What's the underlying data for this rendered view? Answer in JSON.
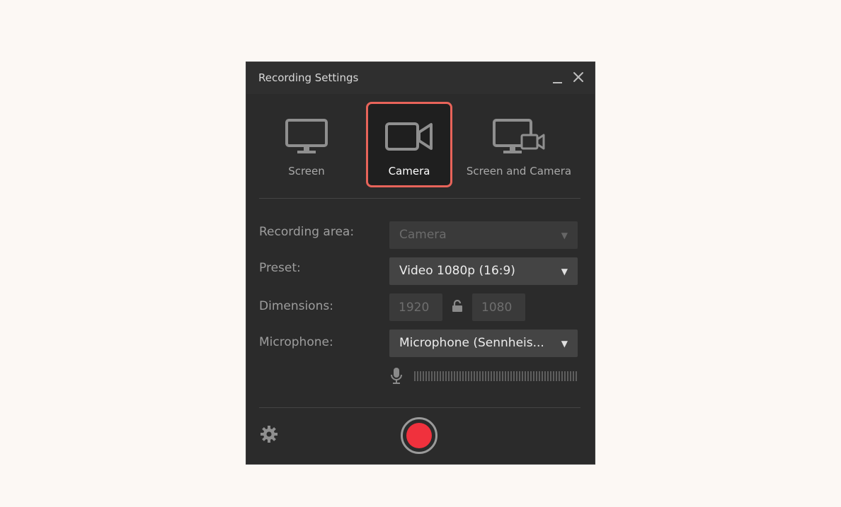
{
  "window": {
    "title": "Recording Settings"
  },
  "modes": [
    {
      "label": "Screen",
      "icon": "monitor-icon",
      "selected": false
    },
    {
      "label": "Camera",
      "icon": "video-camera-icon",
      "selected": true
    },
    {
      "label": "Screen and Camera",
      "icon": "monitor-camera-icon",
      "selected": false
    }
  ],
  "fields": {
    "recording_area": {
      "label": "Recording area:",
      "value": "Camera",
      "enabled": false
    },
    "preset": {
      "label": "Preset:",
      "value": "Video 1080p (16:9)"
    },
    "dimensions": {
      "label": "Dimensions:",
      "width": "1920",
      "height": "1080",
      "locked": false
    },
    "microphone": {
      "label": "Microphone:",
      "value": "Microphone (Sennheis..."
    }
  },
  "colors": {
    "accent_outline": "#e8645a",
    "record": "#f0313d",
    "window_bg": "#2b2b2b"
  },
  "icons": {
    "minimize": "minimize-icon",
    "close": "close-icon",
    "lock": "unlock-icon",
    "mic": "microphone-icon",
    "settings": "gear-icon",
    "record": "record-icon"
  }
}
